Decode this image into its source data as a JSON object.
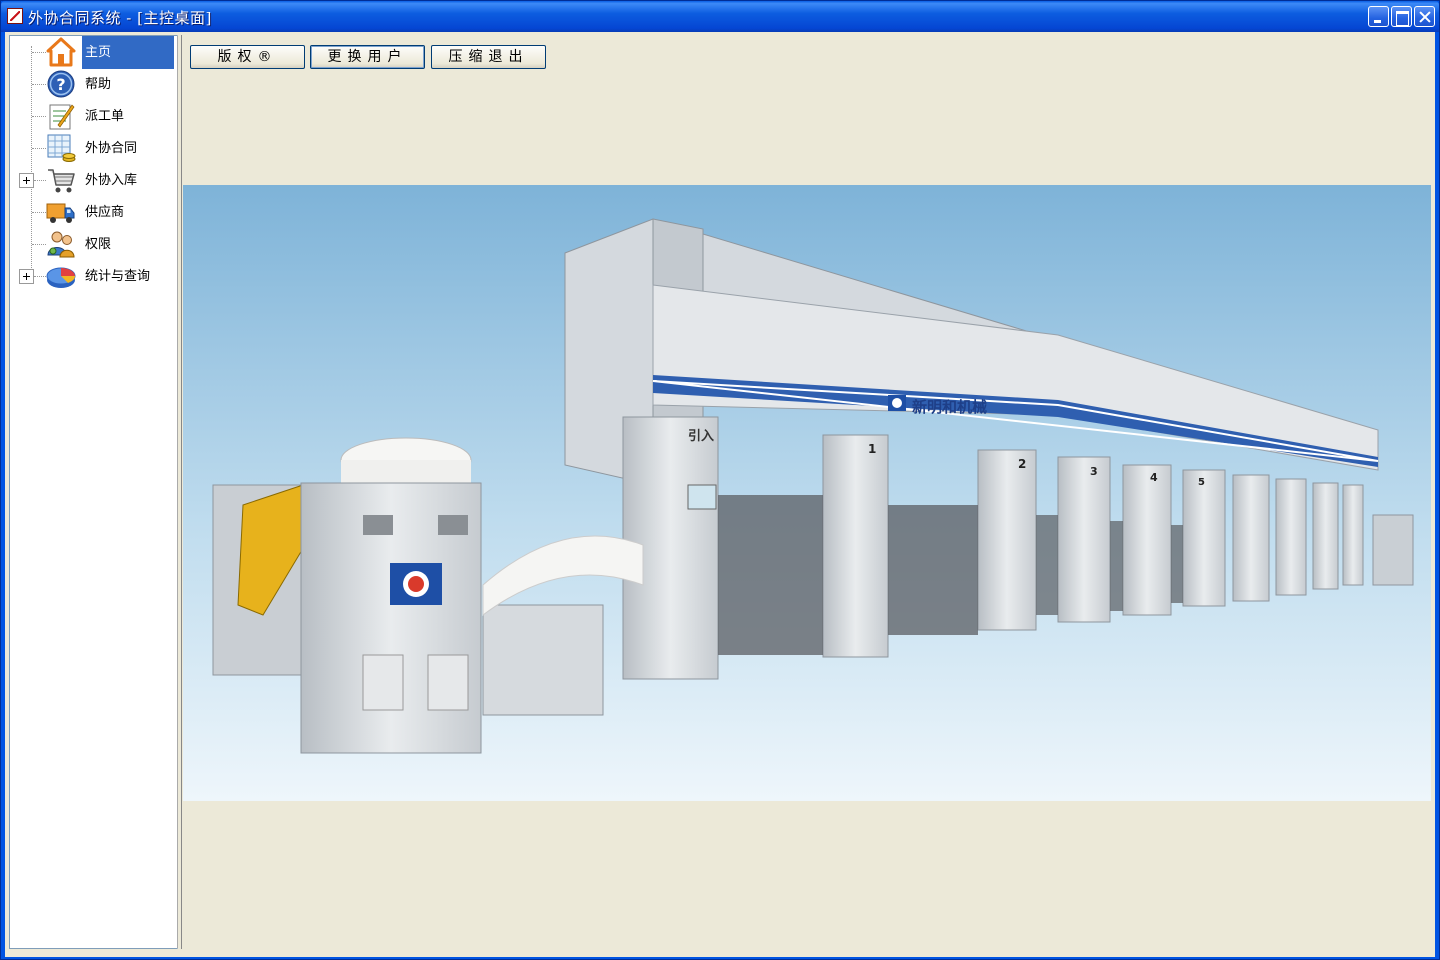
{
  "window": {
    "title": "外协合同系统 - [主控桌面]"
  },
  "sidebar": {
    "items": [
      {
        "label": "主页",
        "icon": "home-icon",
        "selected": true,
        "expandable": false
      },
      {
        "label": "帮助",
        "icon": "help-icon",
        "selected": false,
        "expandable": false
      },
      {
        "label": "派工单",
        "icon": "dispatch-order-icon",
        "selected": false,
        "expandable": false
      },
      {
        "label": "外协合同",
        "icon": "contract-spreadsheet-icon",
        "selected": false,
        "expandable": false
      },
      {
        "label": "外协入库",
        "icon": "shopping-cart-icon",
        "selected": false,
        "expandable": true
      },
      {
        "label": "供应商",
        "icon": "delivery-truck-icon",
        "selected": false,
        "expandable": false
      },
      {
        "label": "权限",
        "icon": "users-permission-icon",
        "selected": false,
        "expandable": false
      },
      {
        "label": "统计与查询",
        "icon": "statistics-disk-icon",
        "selected": false,
        "expandable": true
      }
    ]
  },
  "toolbar": {
    "copyright_label": "版权®",
    "switch_user_label": "更换用户",
    "exit_label": "压缩退出"
  },
  "hero": {
    "machine_brand": "新明和机械",
    "station_label": "引入",
    "station_numbers": [
      "1",
      "2",
      "3",
      "4",
      "5"
    ],
    "sky_color": "#7EB3D8"
  }
}
